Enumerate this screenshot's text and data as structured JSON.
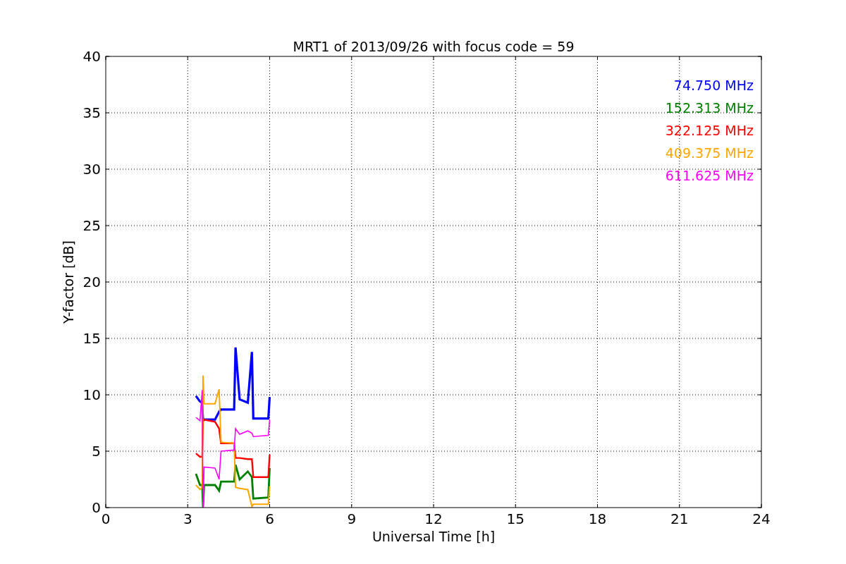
{
  "plot": {
    "chart_data": {
      "type": "line",
      "title": "MRT1 of 2013/09/26 with focus code = 59",
      "xlabel": "Universal Time [h]",
      "ylabel": "Y-factor [dB]",
      "x": [
        3.3,
        3.45,
        3.53,
        3.56,
        3.6,
        4.0,
        4.15,
        4.22,
        4.7,
        4.75,
        4.9,
        5.2,
        5.35,
        5.4,
        5.95,
        6.0
      ],
      "series": [
        {
          "name": "74.750 MHz",
          "color": "#0000ff",
          "values": [
            9.9,
            9.4,
            9.3,
            7.7,
            7.8,
            7.8,
            8.5,
            8.7,
            8.7,
            14.2,
            9.6,
            9.3,
            13.8,
            7.9,
            7.9,
            9.8
          ]
        },
        {
          "name": "152.313 MHz",
          "color": "#008000",
          "values": [
            3.0,
            2.0,
            2.0,
            0.0,
            2.0,
            2.0,
            1.5,
            2.3,
            2.3,
            3.8,
            2.5,
            3.2,
            2.7,
            0.8,
            0.9,
            3.5
          ]
        },
        {
          "name": "322.125 MHz",
          "color": "#ff0000",
          "values": [
            4.8,
            4.5,
            4.5,
            7.8,
            7.8,
            7.6,
            7.0,
            5.7,
            5.7,
            4.4,
            4.4,
            4.3,
            4.3,
            2.7,
            2.7,
            4.7
          ]
        },
        {
          "name": "409.375 MHz",
          "color": "#ffa500",
          "values": [
            2.0,
            1.6,
            1.8,
            11.7,
            9.2,
            9.2,
            10.5,
            5.8,
            5.7,
            1.8,
            1.7,
            1.6,
            0.1,
            0.3,
            0.3,
            1.9
          ]
        },
        {
          "name": "611.625 MHz",
          "color": "#ff00ff",
          "values": [
            8.0,
            7.7,
            10.4,
            0.0,
            3.6,
            3.5,
            2.5,
            5.0,
            5.1,
            7.0,
            6.5,
            6.8,
            6.6,
            6.3,
            6.4,
            7.8
          ]
        }
      ],
      "grid": true,
      "xlim": [
        0,
        24
      ],
      "ylim": [
        0,
        40
      ],
      "xticks": [
        0,
        3,
        6,
        9,
        12,
        15,
        18,
        21,
        24
      ],
      "yticks": [
        0,
        5,
        10,
        15,
        20,
        25,
        30,
        35,
        40
      ]
    }
  }
}
